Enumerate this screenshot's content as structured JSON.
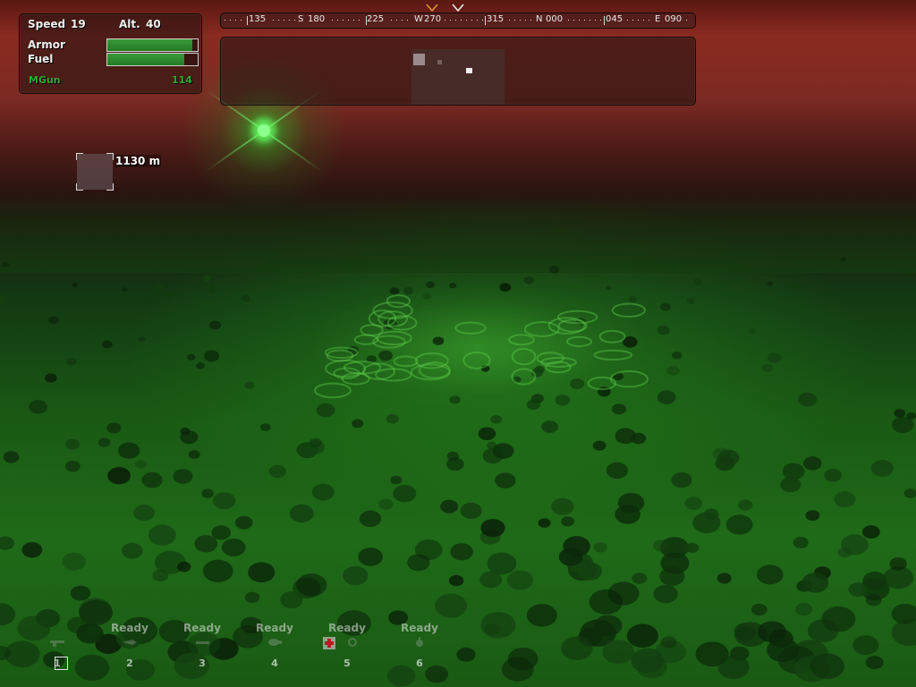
{
  "status": {
    "speed_label": "Speed",
    "speed_value": "19",
    "alt_label": "Alt.",
    "alt_value": "40",
    "armor_label": "Armor",
    "armor_level": 0.94,
    "fuel_label": "Fuel",
    "fuel_level": 0.85,
    "weapon_name": "MGun",
    "weapon_ammo": "114"
  },
  "compass": {
    "labels": [
      "135",
      "S",
      "180",
      "225",
      "W",
      "270",
      "315",
      "N",
      "000",
      "045",
      "E",
      "090"
    ]
  },
  "target": {
    "distance": "1130 m"
  },
  "slots": [
    {
      "number": "1",
      "status": "",
      "icon": "machine-gun-icon"
    },
    {
      "number": "2",
      "status": "Ready",
      "icon": "rocket-icon"
    },
    {
      "number": "3",
      "status": "Ready",
      "icon": "missile-icon"
    },
    {
      "number": "4",
      "status": "Ready",
      "icon": "bomb-icon"
    },
    {
      "number": "5",
      "status": "Ready",
      "icon": "medkit-icon"
    },
    {
      "number": "6",
      "status": "Ready",
      "icon": "mine-icon"
    }
  ],
  "colors": {
    "bar_fill": "#2a8a2a",
    "weapon_text": "#2ea82e",
    "sky": "#7b2a22",
    "ground": "#1f6a18"
  }
}
